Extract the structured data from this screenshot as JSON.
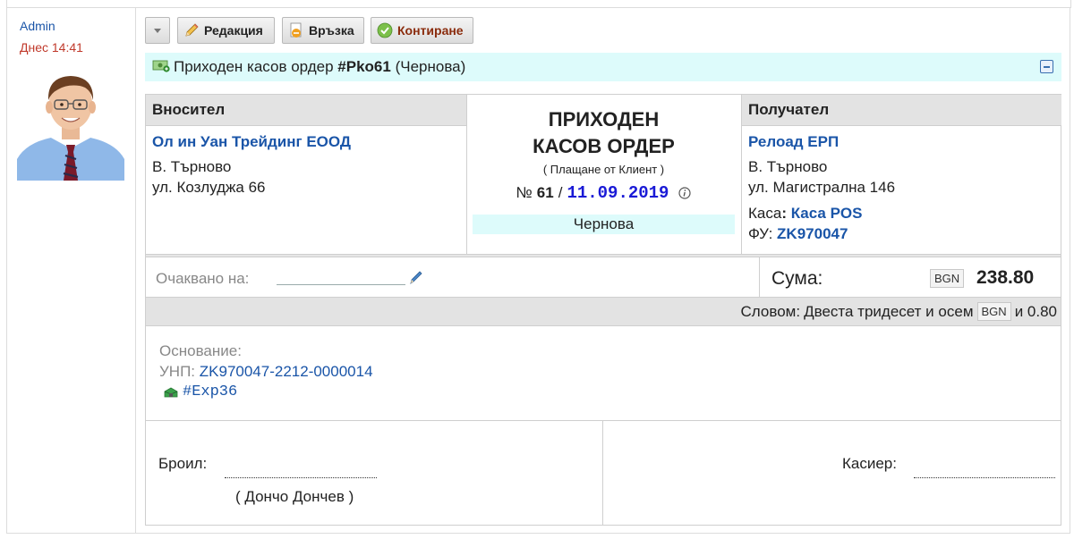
{
  "user": {
    "name": "Admin",
    "time": "Днес 14:41"
  },
  "toolbar": {
    "edit_label": "Редакция",
    "link_label": "Връзка",
    "post_label": "Контиране"
  },
  "document": {
    "title_prefix": "Приходен касов ордер",
    "title_code": "#Pko61",
    "title_status": "(Чернова)"
  },
  "payer": {
    "header": "Вносител",
    "name": "Ол ин Уан Трейдинг ЕООД",
    "city": "В. Търново",
    "address": "ул. Козлуджа 66"
  },
  "order": {
    "title_line1": "ПРИХОДЕН",
    "title_line2": "КАСОВ ОРДЕР",
    "subtitle": "( Плащане от Клиент )",
    "number_prefix": "№",
    "number": "61",
    "separator": "/",
    "date": "11.09.2019",
    "status": "Чернова"
  },
  "receiver": {
    "header": "Получател",
    "name": "Релоад ЕРП",
    "city": "В. Търново",
    "address": "ул. Магистрална 146",
    "cash_label": "Каса",
    "cash_sep": ":",
    "cash_value": "Каса POS",
    "fu_label": "ФУ:",
    "fu_value": "ZK970047"
  },
  "amount": {
    "expected_label": "Очаквано на:",
    "sum_label": "Сума:",
    "currency": "BGN",
    "value": "238.80",
    "words_label": "Словом:",
    "words_text": "Двеста тридесет и осем",
    "words_currency": "BGN",
    "words_tail": "и 0.80"
  },
  "basis": {
    "label": "Основание:",
    "unp_label": "УНП:",
    "unp_value": "ZK970047-2212-0000014",
    "exp_code": "#Exp36"
  },
  "signatures": {
    "counted_label": "Броил:",
    "counted_name": "( Дончо Дончев )",
    "cashier_label": "Касиер:"
  },
  "colors": {
    "link_blue": "#1a55a8",
    "status_cyan": "#ddfbfb",
    "header_gray": "#e3e3e3",
    "time_red": "#c0392b",
    "date_blue": "#1a1ad6"
  }
}
